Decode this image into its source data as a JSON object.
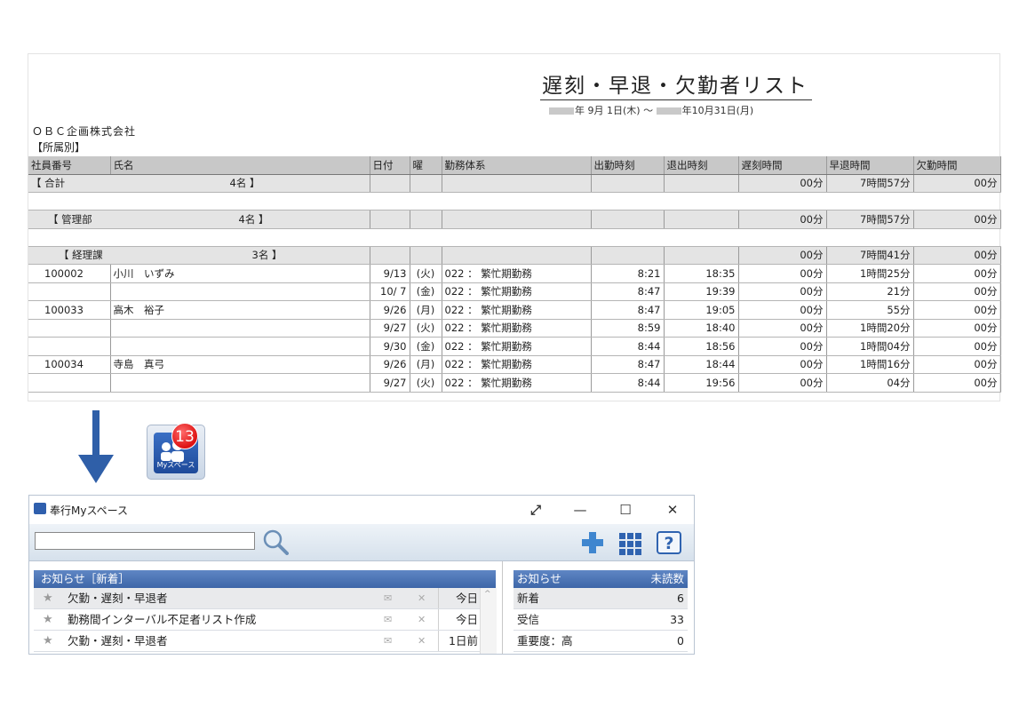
{
  "report": {
    "title": "遅刻・早退・欠勤者リスト",
    "period_start": "年 9月 1日(木)",
    "period_tilde": "〜",
    "period_end": "年10月31日(月)",
    "company": "ＯＢＣ企画株式会社",
    "grouping": "【所属別】",
    "columns": [
      "社員番号",
      "氏名",
      "日付",
      "曜",
      "勤務体系",
      "出勤時刻",
      "退出時刻",
      "遅刻時間",
      "早退時間",
      "欠勤時間"
    ],
    "total_row": {
      "label": "【 合計",
      "count": "4名 】",
      "late": "00分",
      "early": "7時間57分",
      "absent": "00分"
    },
    "dept_row": {
      "label": "【 管理部",
      "count": "4名 】",
      "late": "00分",
      "early": "7時間57分",
      "absent": "00分"
    },
    "section_row": {
      "label": "【 経理課",
      "count": "3名 】",
      "late": "00分",
      "early": "7時間41分",
      "absent": "00分"
    },
    "rows": [
      {
        "id": "100002",
        "name": "小川　いずみ",
        "date": "9/13",
        "dow": "(火)",
        "shift": "022 ：  繁忙期勤務",
        "in": "8:21",
        "out": "18:35",
        "late": "00分",
        "early": "1時間25分",
        "absent": "00分"
      },
      {
        "id": "",
        "name": "",
        "date": "10/ 7",
        "dow": "(金)",
        "shift": "022 ：  繁忙期勤務",
        "in": "8:47",
        "out": "19:39",
        "late": "00分",
        "early": "21分",
        "absent": "00分"
      },
      {
        "id": "100033",
        "name": "高木　裕子",
        "date": "9/26",
        "dow": "(月)",
        "shift": "022 ：  繁忙期勤務",
        "in": "8:47",
        "out": "19:05",
        "late": "00分",
        "early": "55分",
        "absent": "00分"
      },
      {
        "id": "",
        "name": "",
        "date": "9/27",
        "dow": "(火)",
        "shift": "022 ：  繁忙期勤務",
        "in": "8:59",
        "out": "18:40",
        "late": "00分",
        "early": "1時間20分",
        "absent": "00分"
      },
      {
        "id": "",
        "name": "",
        "date": "9/30",
        "dow": "(金)",
        "shift": "022 ：  繁忙期勤務",
        "in": "8:44",
        "out": "18:56",
        "late": "00分",
        "early": "1時間04分",
        "absent": "00分"
      },
      {
        "id": "100034",
        "name": "寺島　真弓",
        "date": "9/26",
        "dow": "(月)",
        "shift": "022 ：  繁忙期勤務",
        "in": "8:47",
        "out": "18:44",
        "late": "00分",
        "early": "1時間16分",
        "absent": "00分"
      },
      {
        "id": "",
        "name": "",
        "date": "9/27",
        "dow": "(火)",
        "shift": "022 ：  繁忙期勤務",
        "in": "8:44",
        "out": "19:56",
        "late": "00分",
        "early": "04分",
        "absent": "00分"
      }
    ]
  },
  "app_icon": {
    "badge": "13",
    "label": "Myスペース",
    "icon": "my-space-app-icon",
    "badge_color": "#dd1111"
  },
  "arrow_color": "#2f5fa8",
  "window": {
    "title": "奉行Myスペース",
    "expand_glyph": "⤢",
    "minimize_glyph": "—",
    "maximize_glyph": "☐",
    "close_glyph": "✕",
    "search_value": "",
    "news_header": "お知らせ［新着］",
    "news": [
      {
        "star": "★",
        "text": "欠勤・遅刻・早退者",
        "mail": "✉",
        "del": "✕",
        "date": "今日"
      },
      {
        "star": "★",
        "text": "勤務間インターバル不足者リスト作成",
        "mail": "✉",
        "del": "✕",
        "date": "今日"
      },
      {
        "star": "★",
        "text": "欠勤・遅刻・早退者",
        "mail": "✉",
        "del": "✕",
        "date": "1日前"
      }
    ],
    "scroll_up": "^",
    "unread_header": "お知らせ",
    "unread_header_right": "未読数",
    "unread": [
      {
        "label": "新着",
        "value": "6"
      },
      {
        "label": "受信",
        "value": "33"
      },
      {
        "label": "重要度：高",
        "value": "0"
      }
    ],
    "help_glyph": "?",
    "accent": "#3d66a8"
  }
}
